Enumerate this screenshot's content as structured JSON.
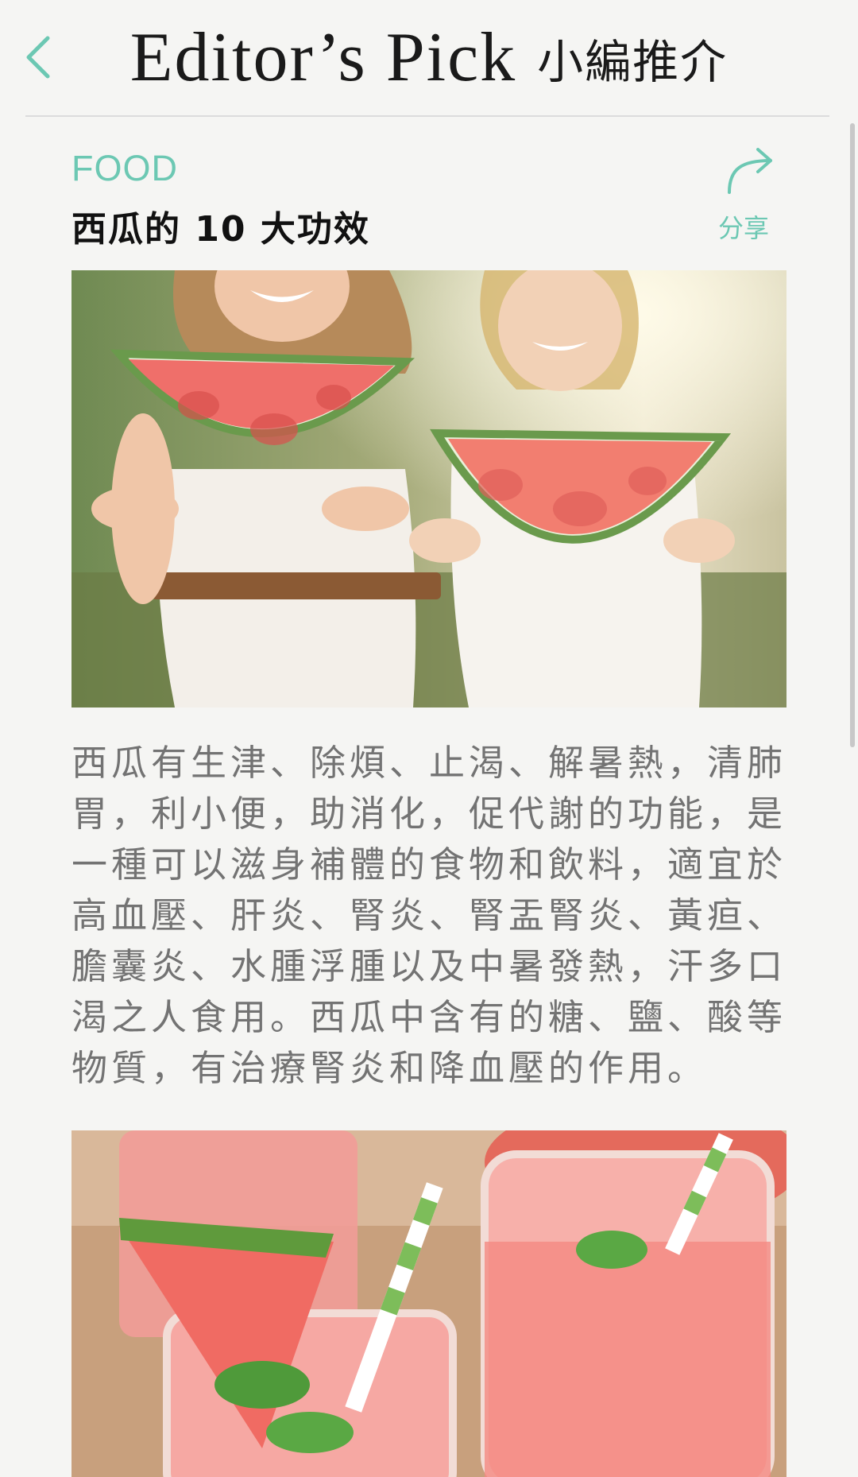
{
  "header": {
    "title_en": "Editor’s Pick",
    "title_zh": "小編推介",
    "back_icon": "chevron-left-icon",
    "accent_color": "#6cc8b3"
  },
  "article": {
    "category": "FOOD",
    "title": "西瓜的 10 大功效",
    "share_label": "分享",
    "share_icon": "share-arrow-icon",
    "hero_image": "two-women-holding-watermelon-slices",
    "body": "西瓜有生津、除煩、止渴、解暑熱，清肺胃，利小便，助消化，促代謝的功能，是一種可以滋身補體的食物和飲料，適宜於高血壓、肝炎、腎炎、腎盂腎炎、黃疸、膽囊炎、水腫浮腫以及中暑發熱，汗多口渴之人食用。西瓜中含有的糖、鹽、酸等物質，有治療腎炎和降血壓的作用。",
    "second_image": "watermelon-drinks-with-straws"
  }
}
